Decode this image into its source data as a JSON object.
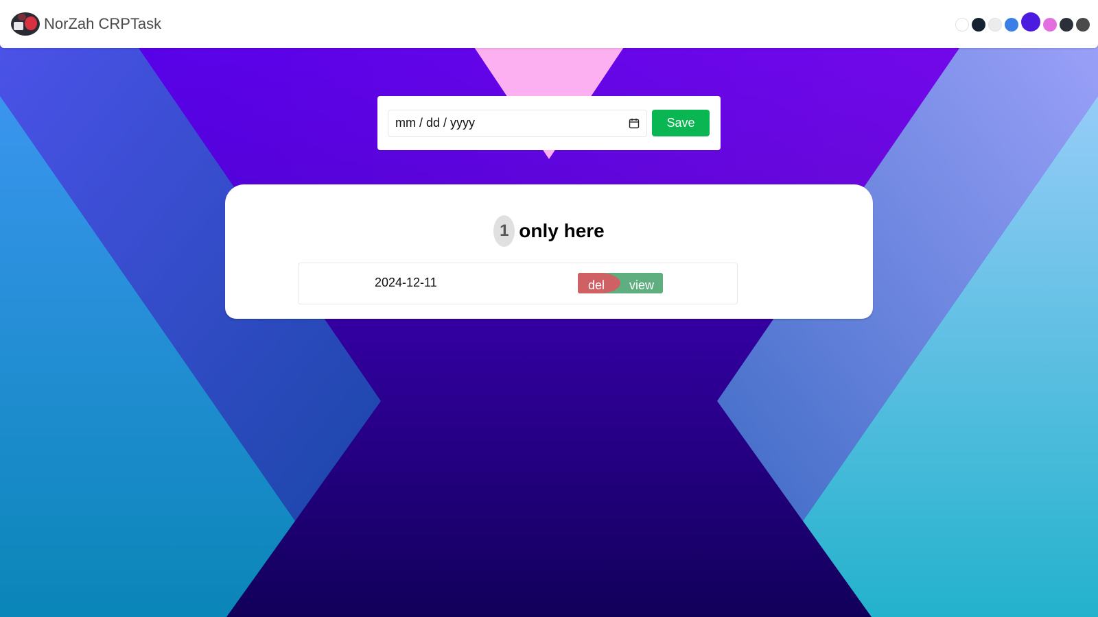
{
  "app": {
    "title": "NorZah CRPTask"
  },
  "theme_dots": [
    {
      "name": "theme-white",
      "color": "#ffffff"
    },
    {
      "name": "theme-dark",
      "color": "#152232"
    },
    {
      "name": "theme-light-gray",
      "color": "#ececec"
    },
    {
      "name": "theme-blue",
      "color": "#3b7fe6"
    },
    {
      "name": "theme-x-purple",
      "color": "#4b1be0"
    },
    {
      "name": "theme-pink",
      "color": "#e26ee0"
    },
    {
      "name": "theme-photo-dark",
      "color": "#2b2f3a"
    },
    {
      "name": "theme-photo-gray",
      "color": "#4a4a4a"
    }
  ],
  "date_form": {
    "placeholder": "mm / dd / yyyy",
    "save_label": "Save"
  },
  "list": {
    "count": "1",
    "heading": "only here",
    "entries": [
      {
        "date": "2024-12-11",
        "delete_label": "del",
        "view_label": "view"
      }
    ]
  },
  "colors": {
    "save": "#0ab652",
    "delete": "#cf6064",
    "view": "#5fae7f"
  }
}
